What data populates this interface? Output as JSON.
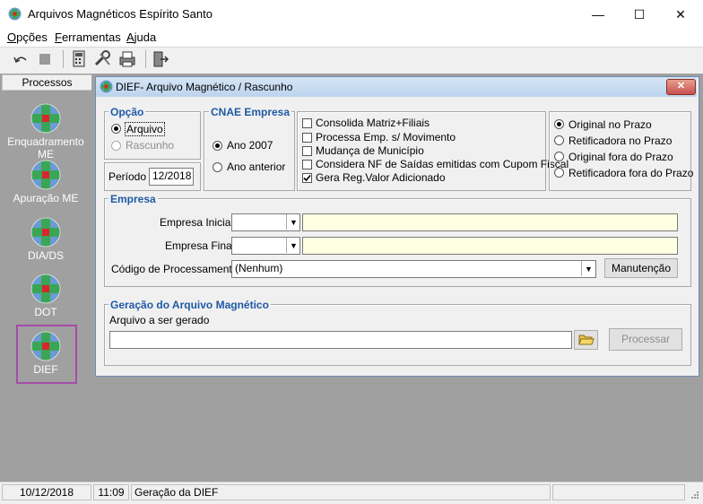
{
  "window": {
    "title": "Arquivos Magnéticos Espírito Santo",
    "minimize_symbol": "—",
    "maximize_symbol": "☐",
    "close_symbol": "✕"
  },
  "menu": {
    "items": [
      {
        "accel": "O",
        "rest": "pções"
      },
      {
        "accel": "F",
        "rest": "erramentas"
      },
      {
        "accel": "A",
        "rest": "juda"
      }
    ]
  },
  "toolbar": {
    "icons": [
      "undo-icon",
      "stop-icon",
      "calculator-icon",
      "tools-icon",
      "printer-icon",
      "exit-door-icon"
    ]
  },
  "sidebar": {
    "header": "Processos",
    "items": [
      {
        "label": "Enquadramento ME"
      },
      {
        "label": "Apuração ME"
      },
      {
        "label": "DIA/DS"
      },
      {
        "label": "DOT"
      },
      {
        "label": "DIEF"
      }
    ],
    "selected": "DIEF"
  },
  "child": {
    "title": "DIEF- Arquivo Magnético / Rascunho",
    "close_symbol": "✕",
    "opcao": {
      "title": "Opção",
      "arquivo": "Arquivo",
      "rascunho": "Rascunho"
    },
    "periodo": {
      "label": "Período",
      "value": "12/2018"
    },
    "cnae": {
      "title": "CNAE Empresa",
      "ano2007": "Ano 2007",
      "anterior": "Ano anterior"
    },
    "checks": [
      {
        "label": "Consolida Matriz+Filiais",
        "checked": false
      },
      {
        "label": "Processa Emp. s/ Movimento",
        "checked": false
      },
      {
        "label": "Mudança de Município",
        "checked": false
      },
      {
        "label": "Considera NF de Saídas emitidas com Cupom Fiscal",
        "checked": false
      },
      {
        "label": "Gera Reg.Valor Adicionado",
        "checked": true
      }
    ],
    "tipo": [
      {
        "label": "Original no Prazo",
        "selected": true
      },
      {
        "label": "Retificadora no Prazo",
        "selected": false
      },
      {
        "label": "Original fora do Prazo",
        "selected": false
      },
      {
        "label": "Retificadora fora do Prazo",
        "selected": false
      }
    ],
    "empresa": {
      "title": "Empresa",
      "inicial_label": "Empresa Inicial",
      "final_label": "Empresa Final",
      "codigo_label": "Código de Processamento",
      "codigo_value": "(Nenhum)",
      "manutencao": "Manutenção"
    },
    "geracao": {
      "title": "Geração do Arquivo Magnético",
      "arquivo_label": "Arquivo a ser gerado",
      "processar": "Processar"
    }
  },
  "status": {
    "date": "10/12/2018",
    "time": "11:09",
    "message": "Geração da DIEF"
  },
  "colors": {
    "group_title": "#1f5aa6",
    "selection_border": "#a64ca6",
    "mdi_background": "#a0a0a0"
  }
}
